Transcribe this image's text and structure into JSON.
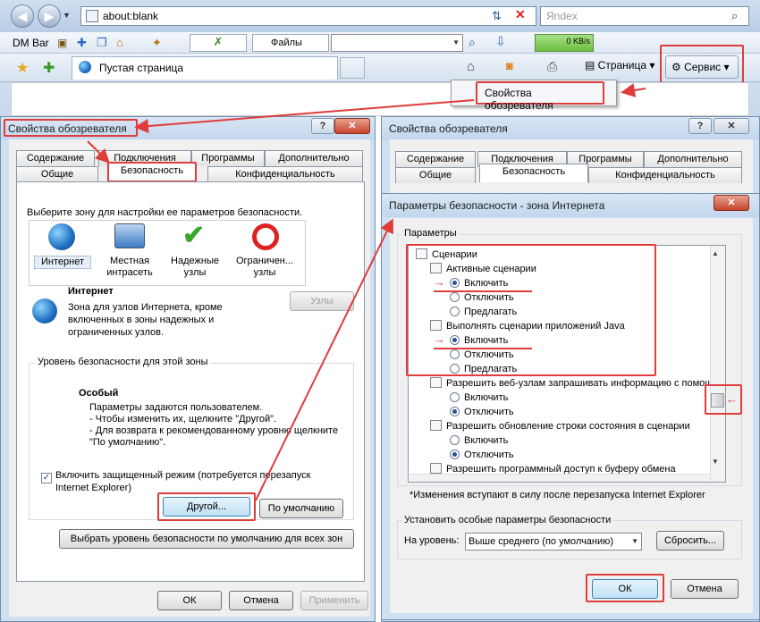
{
  "browser": {
    "address": "about:blank",
    "search_placeholder": "Яndex",
    "toolbar_dm": "DM Bar",
    "files_label": "Файлы",
    "speed": "0 KB/s",
    "tab_title": "Пустая страница",
    "page_menu": "Страница",
    "service_menu": "Сервис",
    "service_item": "Свойства обозревателя"
  },
  "left_dialog": {
    "title": "Свойства обозревателя",
    "tabs_row1": [
      "Содержание",
      "Подключения",
      "Программы",
      "Дополнительно"
    ],
    "tabs_row2": [
      "Общие",
      "Безопасность",
      "Конфиденциальность"
    ],
    "zone_prompt": "Выберите зону для настройки ее параметров безопасности.",
    "zones": [
      "Интернет",
      "Местная интрасеть",
      "Надежные узлы",
      "Ограничен... узлы"
    ],
    "zone_name": "Интернет",
    "zone_desc": "Зона для узлов Интернета, кроме включенных в зоны надежных и ограниченных узлов.",
    "sites_button": "Узлы",
    "level_group": "Уровень безопасности для этой зоны",
    "level_title": "Особый",
    "level_lines": [
      "Параметры задаются пользователем.",
      "- Чтобы изменить их, щелкните \"Другой\".",
      "- Для возврата к рекомендованному уровню щелкните",
      "\"По умолчанию\"."
    ],
    "protected_mode": "Включить защищенный режим (потребуется перезапуск",
    "protected_mode2": "Internet Explorer)",
    "custom_button": "Другой...",
    "default_button": "По умолчанию",
    "reset_all_button": "Выбрать уровень безопасности по умолчанию для всех зон",
    "ok": "ОК",
    "cancel": "Отмена",
    "apply": "Применить"
  },
  "right_dialog": {
    "title": "Свойства обозревателя",
    "tabs_row1": [
      "Содержание",
      "Подключения",
      "Программы",
      "Дополнительно"
    ],
    "tabs_row2": [
      "Общие",
      "Безопасность",
      "Конфиденциальность"
    ]
  },
  "security_dialog": {
    "title": "Параметры безопасности - зона Интернета",
    "params_group": "Параметры",
    "tree": [
      {
        "kind": "header",
        "text": "Сценарии"
      },
      {
        "kind": "setting",
        "text": "Активные сценарии"
      },
      {
        "kind": "option",
        "text": "Включить",
        "checked": true,
        "marked": true
      },
      {
        "kind": "option",
        "text": "Отключить",
        "checked": false
      },
      {
        "kind": "option",
        "text": "Предлагать",
        "checked": false
      },
      {
        "kind": "setting",
        "text": "Выполнять сценарии приложений Java"
      },
      {
        "kind": "option",
        "text": "Включить",
        "checked": true,
        "marked": true
      },
      {
        "kind": "option",
        "text": "Отключить",
        "checked": false
      },
      {
        "kind": "option",
        "text": "Предлагать",
        "checked": false
      },
      {
        "kind": "setting",
        "text": "Разрешить веб-узлам запрашивать информацию с помощ"
      },
      {
        "kind": "option",
        "text": "Включить",
        "checked": false
      },
      {
        "kind": "option",
        "text": "Отключить",
        "checked": true
      },
      {
        "kind": "setting",
        "text": "Разрешить обновление строки состояния в сценарии"
      },
      {
        "kind": "option",
        "text": "Включить",
        "checked": false
      },
      {
        "kind": "option",
        "text": "Отключить",
        "checked": true
      },
      {
        "kind": "setting",
        "text": "Разрешить программный доступ к буферу обмена"
      }
    ],
    "note": "*Изменения вступают в силу после перезапуска Internet Explorer",
    "reset_group": "Установить особые параметры безопасности",
    "level_label": "На уровень:",
    "level_value": "Выше среднего (по умолчанию)",
    "reset_button": "Сбросить...",
    "ok": "ОК",
    "cancel": "Отмена"
  },
  "colors": {
    "annotation": "#e03c3c",
    "title_bar": "#cfe0f2"
  }
}
